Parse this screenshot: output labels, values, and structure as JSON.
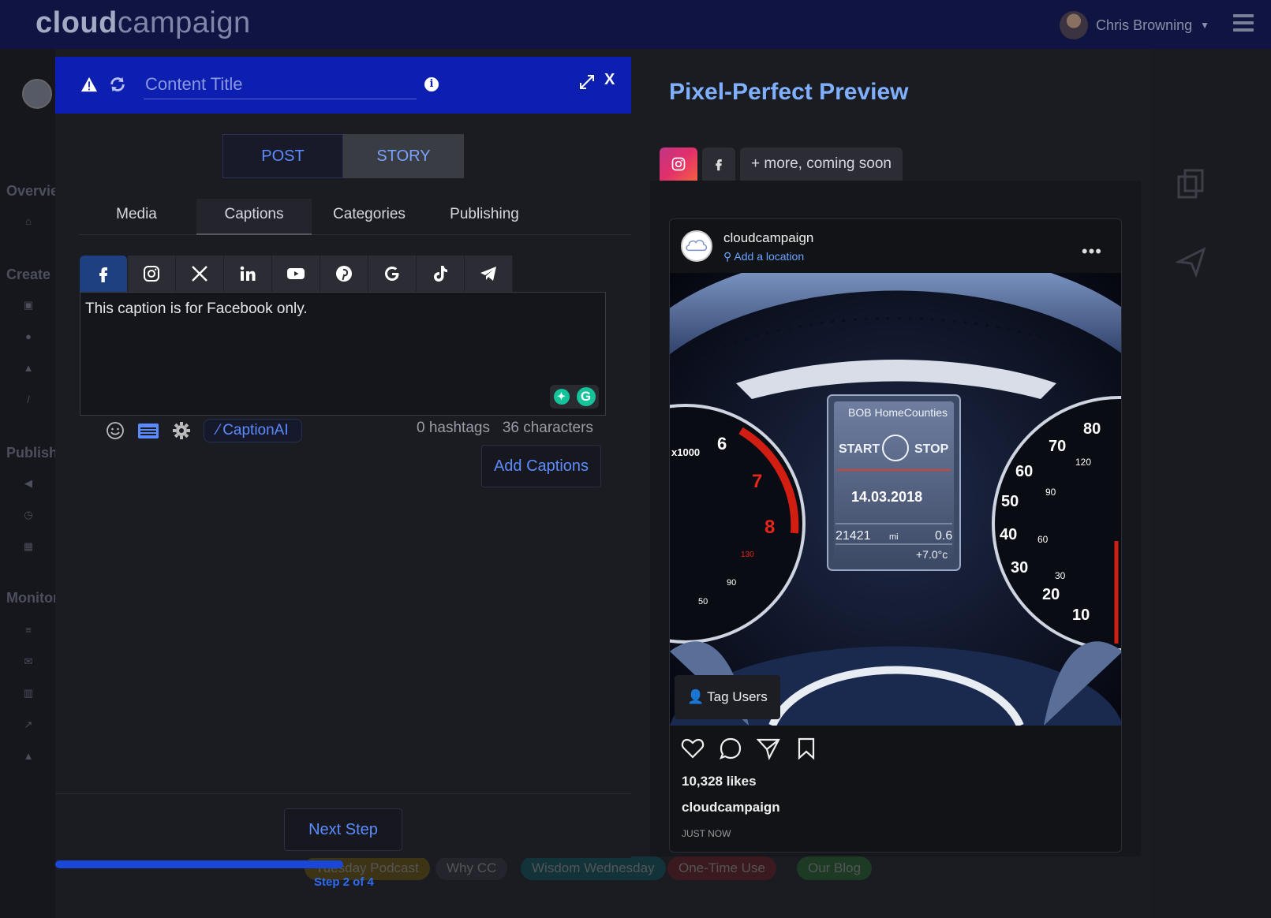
{
  "app": {
    "logo_bold": "cloud",
    "logo_light": "campaign",
    "user_name": "Chris Browning"
  },
  "nav": {
    "sections": [
      "Overview",
      "Create",
      "Publish",
      "Monitor"
    ]
  },
  "background": {
    "tags": [
      "Tuesday Podcast",
      "Why CC",
      "Wisdom Wednesday",
      "One-Time Use",
      "Our Blog"
    ]
  },
  "editor": {
    "title_placeholder": "Content Title",
    "close_label": "X",
    "modes": {
      "post": "POST",
      "story": "STORY",
      "active": "POST"
    },
    "subtabs": [
      "Media",
      "Captions",
      "Categories",
      "Publishing"
    ],
    "active_subtab": "Captions",
    "platforms": [
      "facebook",
      "instagram",
      "x",
      "linkedin",
      "youtube",
      "pinterest",
      "google",
      "tiktok",
      "telegram"
    ],
    "active_platform": "facebook",
    "caption_text": "This caption is for Facebook only.",
    "caption_ai_label": "CaptionAI",
    "hashtags": "0 hashtags",
    "characters": "36 characters",
    "add_captions_label": "Add Captions",
    "next_step_label": "Next Step",
    "progress": 0.5,
    "step_label": "Step 2 of 4"
  },
  "preview": {
    "title": "Pixel-Perfect Preview",
    "more_tab": "+ more, coming soon",
    "post": {
      "username": "cloudcampaign",
      "location": "Add a location",
      "tag_users": "Tag Users",
      "likes": "10,328 likes",
      "caption_user": "cloudcampaign",
      "time": "JUST NOW",
      "dash": {
        "brand": "BOB HomeCounties",
        "start": "START",
        "stop": "STOP",
        "date": "14.03.2018",
        "odometer": "21421",
        "unit": "mi",
        "trip": "0.6",
        "temp": "+7.0°c"
      }
    }
  },
  "colors": {
    "topbar": "#0f1442",
    "modal_header": "#0c1fb0",
    "accent": "#5b8cff",
    "preview_title": "#7fb0ff"
  }
}
